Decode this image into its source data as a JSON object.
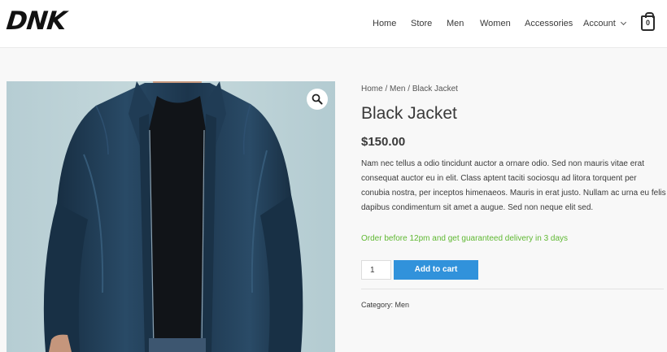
{
  "header": {
    "logo": "DNK",
    "nav": [
      "Home",
      "Store",
      "Men",
      "Women",
      "Accessories",
      "Account"
    ],
    "cart_count": "0"
  },
  "breadcrumb": {
    "home": "Home",
    "sep1": " / ",
    "category": "Men",
    "sep2": " / ",
    "current": "Black Jacket"
  },
  "product": {
    "title": "Black Jacket",
    "price": "$150.00",
    "description": "Nam nec tellus a odio tincidunt auctor a ornare odio. Sed non mauris vitae erat consequat auctor eu in elit. Class aptent taciti sociosqu ad litora torquent per conubia nostra, per inceptos himenaeos. Mauris in erat justo. Nullam ac urna eu felis dapibus condimentum sit amet a augue. Sed non neque elit sed.",
    "promo": "Order before 12pm and get guaranteed delivery in 3 days",
    "quantity": "1",
    "add_to_cart": "Add to cart",
    "category_label": "Category:",
    "category_value": "Men"
  },
  "colors": {
    "accent": "#3192db",
    "promo": "#5fb832",
    "jacket": "#1f3a52",
    "background": "#bcd3d8"
  },
  "icons": {
    "zoom": "magnifier-icon",
    "cart": "shopping-bag-icon",
    "account_dropdown": "chevron-down-icon"
  }
}
